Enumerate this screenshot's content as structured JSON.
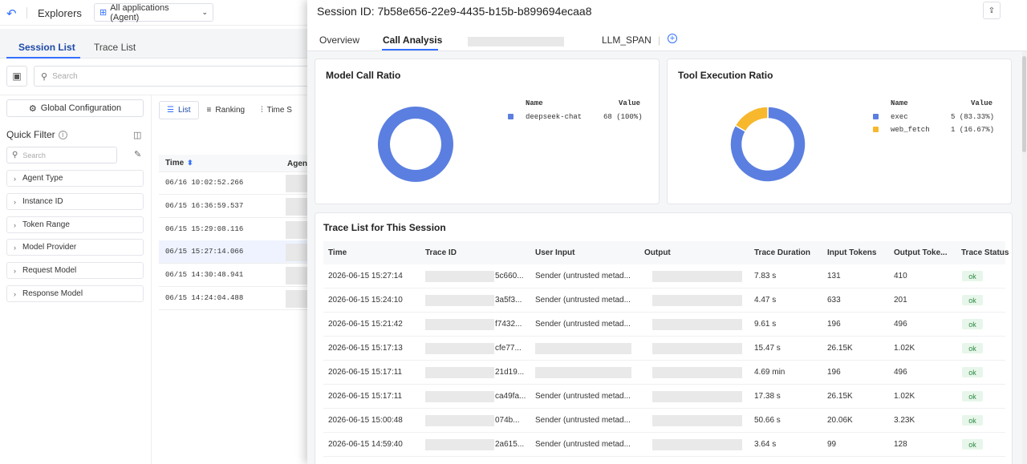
{
  "topbar": {
    "explorers": "Explorers",
    "app_selector": "All applications (Agent)"
  },
  "tabs": [
    "Session List",
    "Trace List"
  ],
  "search_placeholder": "Search",
  "global_config": "Global Configuration",
  "quick_filter": {
    "title": "Quick Filter",
    "search_placeholder": "Search",
    "filters": [
      "Agent Type",
      "Instance ID",
      "Token Range",
      "Model Provider",
      "Request Model",
      "Response Model"
    ]
  },
  "view_tabs": [
    "List",
    "Ranking",
    "Time S"
  ],
  "session_table": {
    "time_header": "Time",
    "agent_header": "Agen",
    "rows": [
      "06/16 10:02:52.266",
      "06/15 16:36:59.537",
      "06/15 15:29:08.116",
      "06/15 15:27:14.066",
      "06/15 14:30:48.941",
      "06/15 14:24:04.488"
    ]
  },
  "drawer": {
    "title": "Session ID: 7b58e656-22e9-4435-b15b-b899694ecaa8",
    "tabs": {
      "overview": "Overview",
      "call_analysis": "Call Analysis",
      "llm_span": "LLM_SPAN"
    },
    "model_call": {
      "title": "Model Call Ratio",
      "legend_name": "Name",
      "legend_value": "Value",
      "items": [
        {
          "name": "deepseek-chat",
          "value": "68 (100%)",
          "count": 68,
          "color": "#5b7fe0"
        }
      ]
    },
    "tool_exec": {
      "title": "Tool Execution Ratio",
      "legend_name": "Name",
      "legend_value": "Value",
      "items": [
        {
          "name": "exec",
          "value": "5 (83.33%)",
          "count": 5,
          "color": "#5b7fe0"
        },
        {
          "name": "web_fetch",
          "value": "1 (16.67%)",
          "count": 1,
          "color": "#f7b82e"
        }
      ]
    },
    "trace_table": {
      "title": "Trace List for This Session",
      "columns": [
        "Time",
        "Trace ID",
        "User Input",
        "Output",
        "Trace Duration",
        "Input Tokens",
        "Output Toke...",
        "Trace Status"
      ],
      "rows": [
        {
          "time": "2026-06-15 15:27:14",
          "trace_id": "5c660...",
          "user_input": "Sender (untrusted metad...",
          "duration": "7.83 s",
          "input_tokens": "131",
          "output_tokens": "410",
          "status": "ok"
        },
        {
          "time": "2026-06-15 15:24:10",
          "trace_id": "3a5f3...",
          "user_input": "Sender (untrusted metad...",
          "duration": "4.47 s",
          "input_tokens": "633",
          "output_tokens": "201",
          "status": "ok"
        },
        {
          "time": "2026-06-15 15:21:42",
          "trace_id": "f7432...",
          "user_input": "Sender (untrusted metad...",
          "duration": "9.61 s",
          "input_tokens": "196",
          "output_tokens": "496",
          "status": "ok"
        },
        {
          "time": "2026-06-15 15:17:13",
          "trace_id": "cfe77...",
          "user_input": "",
          "duration": "15.47 s",
          "input_tokens": "26.15K",
          "output_tokens": "1.02K",
          "status": "ok"
        },
        {
          "time": "2026-06-15 15:17:11",
          "trace_id": "21d19...",
          "user_input": "",
          "duration": "4.69 min",
          "input_tokens": "196",
          "output_tokens": "496",
          "status": "ok"
        },
        {
          "time": "2026-06-15 15:17:11",
          "trace_id": "ca49fa...",
          "user_input": "Sender (untrusted metad...",
          "duration": "17.38 s",
          "input_tokens": "26.15K",
          "output_tokens": "1.02K",
          "status": "ok"
        },
        {
          "time": "2026-06-15 15:00:48",
          "trace_id": "074b...",
          "user_input": "Sender (untrusted metad...",
          "duration": "50.66 s",
          "input_tokens": "20.06K",
          "output_tokens": "3.23K",
          "status": "ok"
        },
        {
          "time": "2026-06-15 14:59:40",
          "trace_id": "2a615...",
          "user_input": "Sender (untrusted metad...",
          "duration": "3.64 s",
          "input_tokens": "99",
          "output_tokens": "128",
          "status": "ok"
        }
      ]
    }
  }
}
